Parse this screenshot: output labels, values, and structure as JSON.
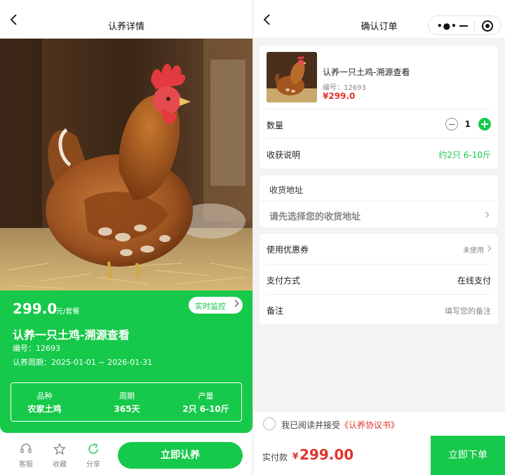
{
  "left_page": {
    "nav": {
      "title": "认养详情"
    },
    "product": {
      "price": "299.0",
      "price_unit": "元/套餐",
      "monitor_label": "实时监控",
      "title": "认养一只土鸡-溯源查看",
      "code": "编号：12693",
      "period": "认养周期：2025-01-01 ~ 2026-01-31",
      "specs": [
        {
          "label": "品种",
          "value": "农家土鸡"
        },
        {
          "label": "周期",
          "value": "365天"
        },
        {
          "label": "产量",
          "value": "2只 6-10斤"
        }
      ]
    },
    "bottom_bar": {
      "service": "客服",
      "favorite": "收藏",
      "share": "分享",
      "adopt_button": "立即认养"
    }
  },
  "right_page": {
    "nav": {
      "title": "确认订单"
    },
    "order_item": {
      "name": "认养一只土鸡-溯源查看",
      "code": "编号：12693",
      "price": "¥299.0",
      "quantity_label": "数量",
      "quantity": "1",
      "harvest_label": "收获说明",
      "harvest_value": "约2只 6-10斤"
    },
    "address": {
      "header": "收货地址",
      "placeholder": "请先选择您的收货地址"
    },
    "options": {
      "coupon_label": "使用优惠券",
      "coupon_value": "未使用",
      "payment_label": "支付方式",
      "payment_value": "在线支付",
      "remark_label": "备注",
      "remark_placeholder": "填写您的备注"
    },
    "agreement": {
      "text": "我已阅读并接受",
      "link": "《认养协议书》"
    },
    "pay_bar": {
      "label": "实付款",
      "currency": "¥",
      "amount": "299.00",
      "order_button": "立即下单"
    }
  },
  "colors": {
    "brand_green": "#16c94a",
    "price_red": "#e2342c"
  },
  "icons": [
    "back-arrow-icon",
    "more-dots-icon",
    "minimize-icon",
    "close-target-icon",
    "headset-icon",
    "star-icon",
    "share-icon",
    "chevron-right-icon"
  ]
}
